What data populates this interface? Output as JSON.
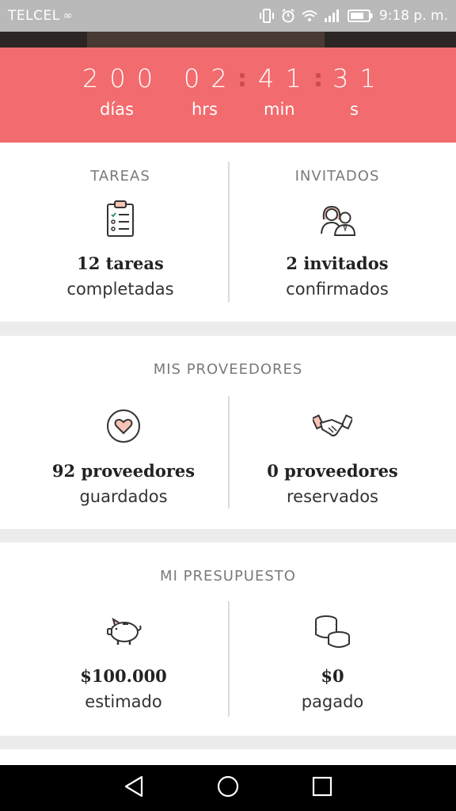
{
  "status_bar": {
    "carrier": "TELCEL",
    "time": "9:18 p. m."
  },
  "countdown": {
    "days": "200",
    "hours": "02",
    "minutes": "41",
    "seconds": "31",
    "days_label": "días",
    "hours_label": "hrs",
    "minutes_label": "min",
    "seconds_label": "s",
    "colors": {
      "background": "#f26b6e",
      "colon": "#c9494c"
    }
  },
  "tasks_card": {
    "tasks": {
      "title": "TAREAS",
      "icon": "clipboard-checklist-icon",
      "value": "12 tareas",
      "label": "completadas"
    },
    "guests": {
      "title": "INVITADOS",
      "icon": "guests-icon",
      "value": "2 invitados",
      "label": "confirmados"
    }
  },
  "vendors_card": {
    "title": "MIS PROVEEDORES",
    "saved": {
      "icon": "heart-circle-icon",
      "value": "92 proveedores",
      "label": "guardados"
    },
    "booked": {
      "icon": "handshake-icon",
      "value": "0 proveedores",
      "label": "reservados"
    }
  },
  "budget_card": {
    "title": "MI PRESUPUESTO",
    "estimated": {
      "icon": "piggy-bank-icon",
      "value": "$100.000",
      "label": "estimado"
    },
    "paid": {
      "icon": "coins-stack-icon",
      "value": "$0",
      "label": "pagado"
    }
  },
  "nav_bar": {
    "back": "back-triangle-icon",
    "home": "home-circle-icon",
    "recents": "recents-square-icon"
  }
}
